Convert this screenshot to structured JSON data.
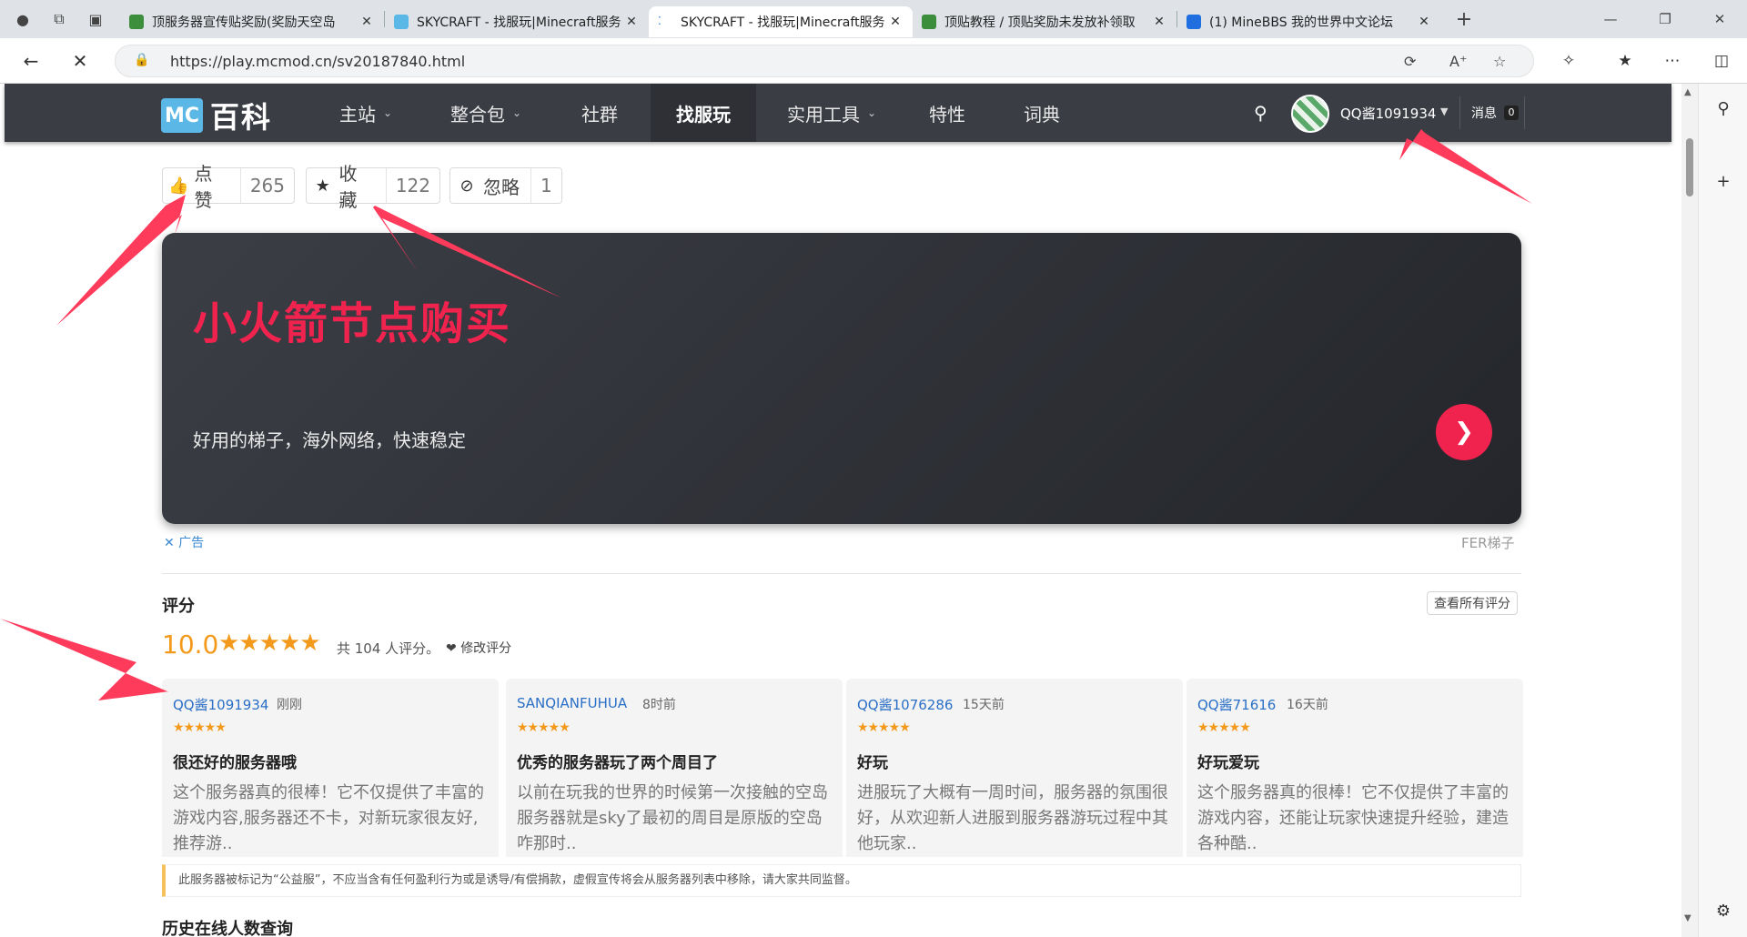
{
  "browser": {
    "tabs": [
      {
        "title": "顶服务器宣传贴奖励(奖励天空岛",
        "favicon_color": "#3c8d3c",
        "active": false
      },
      {
        "title": "SKYCRAFT - 找服玩|Minecraft服务",
        "favicon_color": "#5bb8e6",
        "active": false
      },
      {
        "title": "SKYCRAFT - 找服玩|Minecraft服务",
        "favicon_color": "#ffffff",
        "active": true
      },
      {
        "title": "顶贴教程 / 顶贴奖励未发放补领取",
        "favicon_color": "#3c8d3c",
        "active": false
      },
      {
        "title": "(1) MineBBS 我的世界中文论坛",
        "favicon_color": "#1f6fe0",
        "active": false
      }
    ],
    "url": "https://play.mcmod.cn/sv20187840.html"
  },
  "site": {
    "logo_mc": "MC",
    "logo_text": "百科",
    "nav": [
      {
        "label": "主站",
        "dropdown": true
      },
      {
        "label": "整合包",
        "dropdown": true
      },
      {
        "label": "社群",
        "dropdown": false
      },
      {
        "label": "找服玩",
        "dropdown": false,
        "active": true
      },
      {
        "label": "实用工具",
        "dropdown": true
      },
      {
        "label": "特性",
        "dropdown": false
      },
      {
        "label": "词典",
        "dropdown": false
      }
    ],
    "user": {
      "name": "QQ酱1091934",
      "messages_label": "消息",
      "messages_count": "0"
    }
  },
  "actions": {
    "like": {
      "label": "点赞",
      "count": "265"
    },
    "favorite": {
      "label": "收藏",
      "count": "122"
    },
    "ignore": {
      "label": "忽略",
      "count": "1"
    }
  },
  "ad": {
    "headline": "小火箭节点购买",
    "subtitle": "好用的梯子，海外网络，快速稳定",
    "close_label": "✕ 广告",
    "brand": "FER梯子"
  },
  "rating": {
    "title": "评分",
    "score": "10.0",
    "stars": 5,
    "count_text": "共 104 人评分。",
    "edit_label": "修改评分",
    "view_all": "查看所有评分"
  },
  "reviews": [
    {
      "user": "QQ酱1091934",
      "time": "刚刚",
      "stars": 5,
      "title": "很还好的服务器哦",
      "body": "这个服务器真的很棒！它不仅提供了丰富的游戏内容,服务器还不卡，对新玩家很友好,推荐游.."
    },
    {
      "user": "SANQIANFUHUA",
      "time": "8时前",
      "stars": 5,
      "title": "优秀的服务器玩了两个周目了",
      "body": "以前在玩我的世界的时候第一次接触的空岛服务器就是sky了最初的周目是原版的空岛咋那时.."
    },
    {
      "user": "QQ酱1076286",
      "time": "15天前",
      "stars": 5,
      "title": "好玩",
      "body": "进服玩了大概有一周时间，服务器的氛围很好，从欢迎新人进服到服务器游玩过程中其他玩家.."
    },
    {
      "user": "QQ酱71616",
      "time": "16天前",
      "stars": 5,
      "title": "好玩爱玩",
      "body": "这个服务器真的很棒！它不仅提供了丰富的游戏内容，还能让玩家快速提升经验，建造各种酷.."
    }
  ],
  "notice": "此服务器被标记为“公益服”，不应当含有任何盈利行为或是诱导/有偿捐款，虚假宣传将会从服务器列表中移除，请大家共同监督。",
  "history_title": "历史在线人数查询",
  "colors": {
    "accent_red": "#f0234f",
    "star_orange": "#f39a1c",
    "nav_bg": "#3a3d44",
    "annotation_red": "#ff3b5c"
  }
}
